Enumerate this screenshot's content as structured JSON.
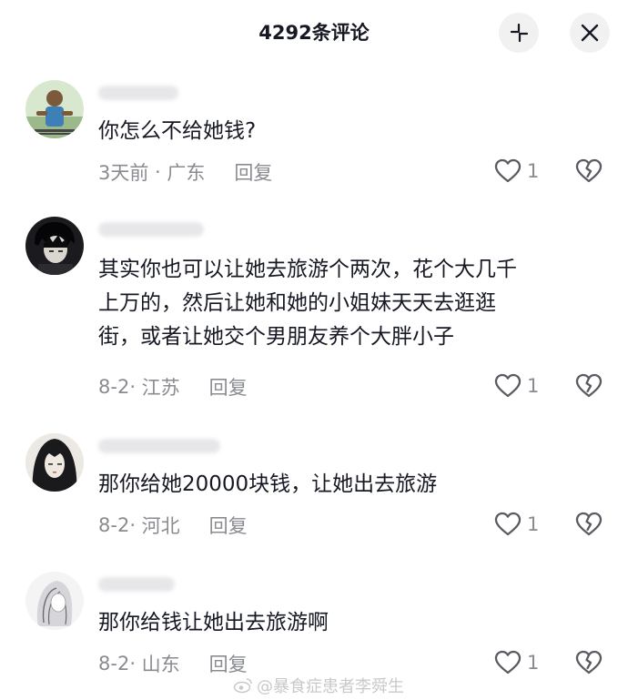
{
  "header": {
    "title": "4292条评论"
  },
  "comments": [
    {
      "text": "你怎么不给她钱?",
      "time": "3天前",
      "location": "广东",
      "reply_label": "回复",
      "likes": "1"
    },
    {
      "text_lines": [
        "其实你也可以让她去旅游个两次，花个大几千",
        "上万的，然后让她和她的小姐妹天天去逛逛",
        "街，或者让她交个男朋友养个大胖小子"
      ],
      "time": "8-2",
      "location": "江苏",
      "reply_label": "回复",
      "likes": "1"
    },
    {
      "text": "那你给她20000块钱，让她出去旅游",
      "time": "8-2",
      "location": "河北",
      "reply_label": "回复",
      "likes": "1"
    },
    {
      "text": "那你给钱让她出去旅游啊",
      "time": "8-2",
      "location": "山东",
      "reply_label": "回复",
      "likes": "1"
    }
  ],
  "watermark": {
    "text": "@暴食症患者李舜生"
  },
  "icons": {
    "collapse": "collapse-icon",
    "close": "close-icon",
    "like": "heart-outline-icon",
    "dislike": "broken-heart-icon"
  },
  "colors": {
    "text": "#161823",
    "meta": "#8a8b91",
    "button_bg": "#f1f1f2"
  }
}
